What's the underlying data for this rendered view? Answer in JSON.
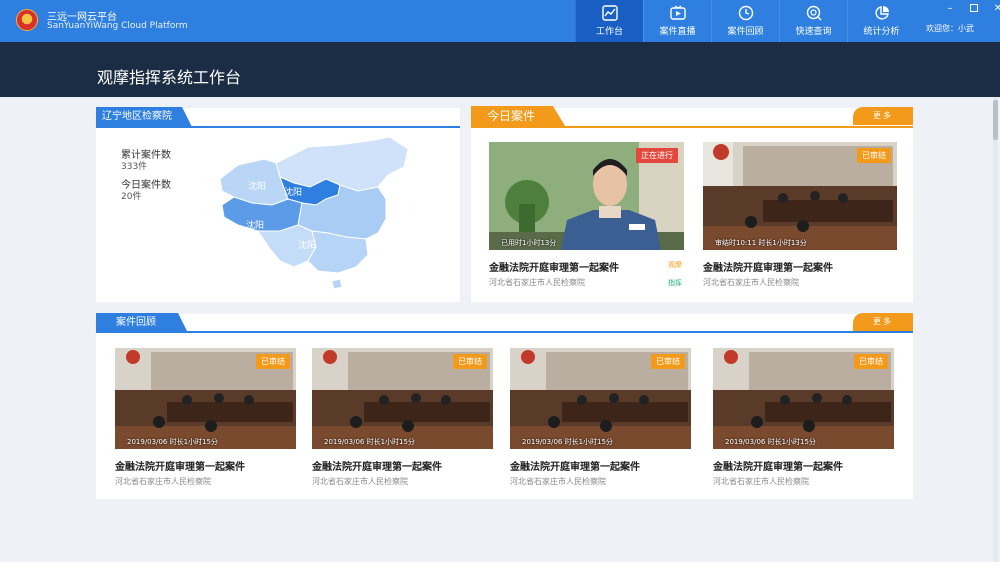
{
  "app": {
    "name_cn": "三远一网云平台",
    "name_en": "SanYuanYiWang Cloud Platform",
    "welcome": "欢迎您：小武"
  },
  "nav": [
    {
      "label": "工作台",
      "icon": "chart-line-icon",
      "active": true
    },
    {
      "label": "案件直播",
      "icon": "live-tv-icon",
      "active": false
    },
    {
      "label": "案件回顾",
      "icon": "clock-icon",
      "active": false
    },
    {
      "label": "快速查询",
      "icon": "search-icon",
      "active": false
    },
    {
      "label": "统计分析",
      "icon": "pie-chart-icon",
      "active": false
    }
  ],
  "page_title": "观摩指挥系统工作台",
  "region": {
    "title": "辽宁地区检察院",
    "total_label": "累计案件数",
    "total_value": "333件",
    "today_label": "今日案件数",
    "today_value": "20件",
    "map_labels": [
      "沈阳",
      "沈阳",
      "沈阳",
      "沈阳"
    ]
  },
  "today": {
    "title": "今日案件",
    "more": "更多",
    "cards": [
      {
        "badge": "正在进行",
        "caption": "已用时1小时13分",
        "title": "金融法院开庭审理第一起案件",
        "org": "河北省石家庄市人民检察院",
        "tags": [
          "观摩",
          "指挥"
        ]
      },
      {
        "badge": "已审结",
        "caption": "审结时10:11  时长1小时13分",
        "title": "金融法院开庭审理第一起案件",
        "org": "河北省石家庄市人民检察院"
      }
    ]
  },
  "review": {
    "title": "案件回顾",
    "more": "更多",
    "cards": [
      {
        "badge": "已审结",
        "caption": "2019/03/06  时长1小时15分",
        "title": "金融法院开庭审理第一起案件",
        "org": "河北省石家庄市人民检察院"
      },
      {
        "badge": "已审结",
        "caption": "2019/03/06  时长1小时15分",
        "title": "金融法院开庭审理第一起案件",
        "org": "河北省石家庄市人民检察院"
      },
      {
        "badge": "已审结",
        "caption": "2019/03/06  时长1小时15分",
        "title": "金融法院开庭审理第一起案件",
        "org": "河北省石家庄市人民检察院"
      },
      {
        "badge": "已审结",
        "caption": "2019/03/06  时长1小时15分",
        "title": "金融法院开庭审理第一起案件",
        "org": "河北省石家庄市人民检察院"
      }
    ]
  },
  "colors": {
    "primary": "#2f7fe0",
    "accent": "#f39a1b",
    "live": "#e2493c",
    "header_dark": "#1b2c45"
  }
}
